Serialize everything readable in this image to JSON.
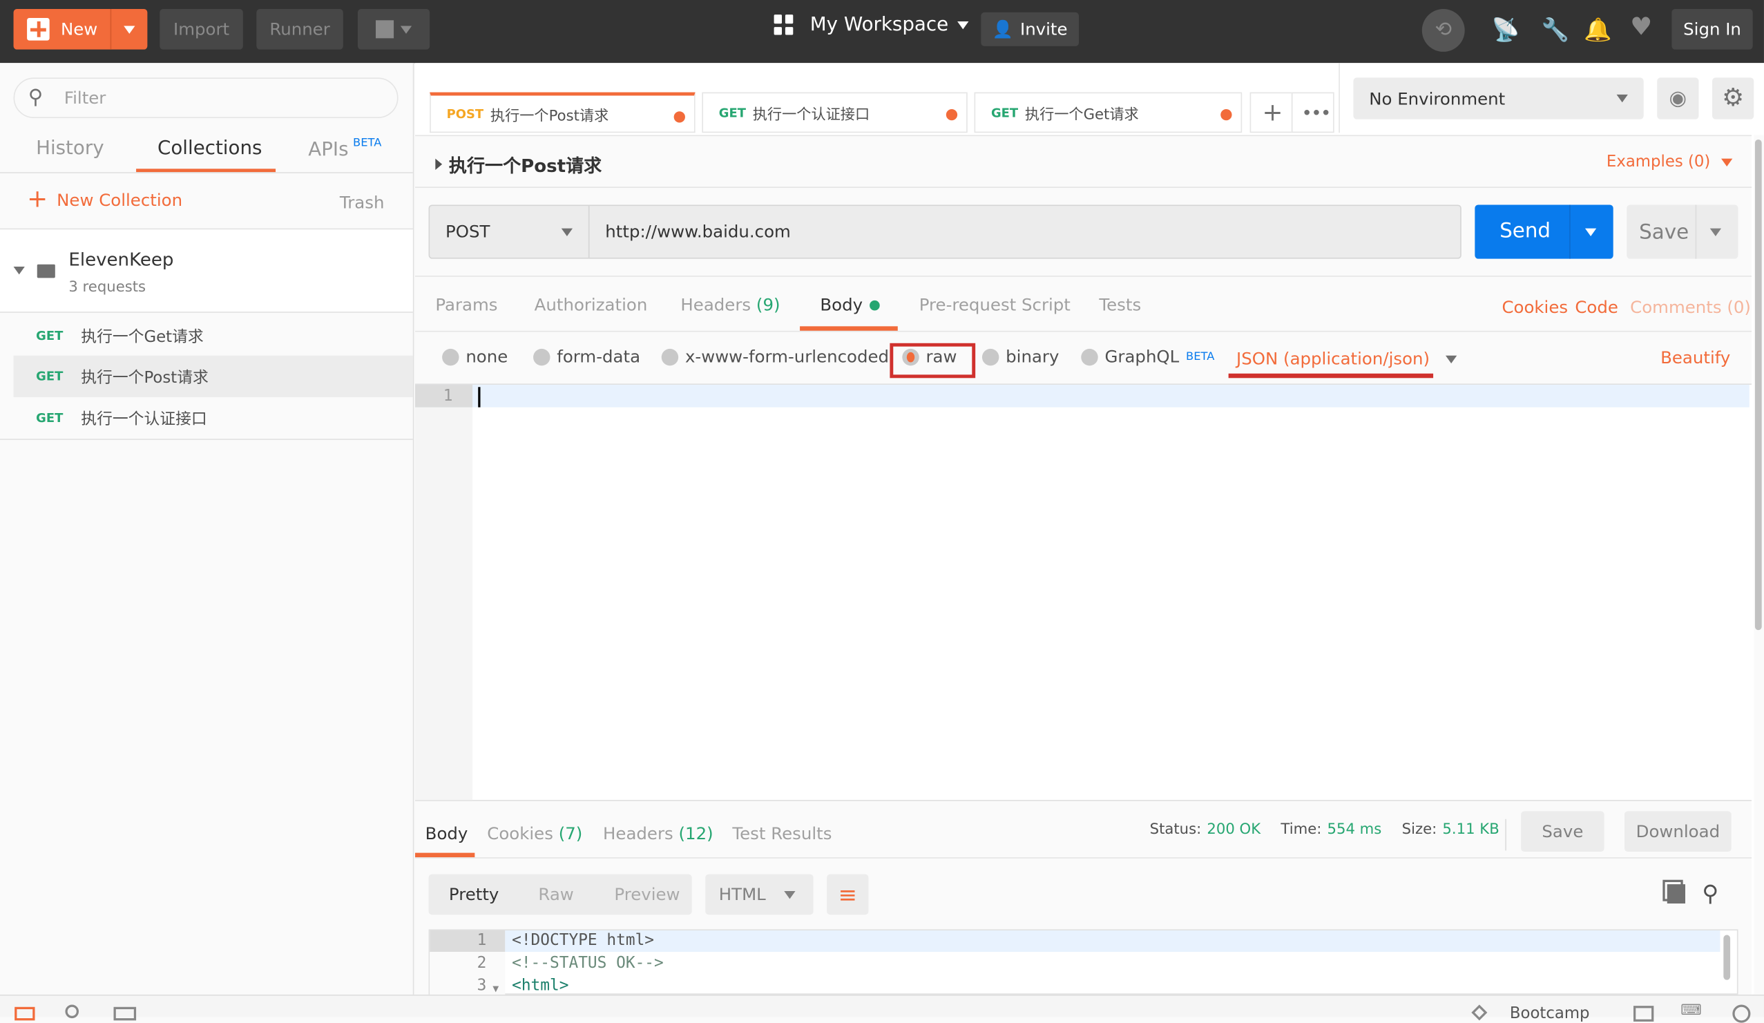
{
  "topbar": {
    "new_label": "New",
    "import_label": "Import",
    "runner_label": "Runner",
    "workspace_label": "My Workspace",
    "invite_label": "Invite",
    "sign_in_label": "Sign In"
  },
  "sidebar": {
    "filter_placeholder": "Filter",
    "tabs": [
      {
        "label": "History"
      },
      {
        "label": "Collections",
        "active": true
      },
      {
        "label": "APIs",
        "badge": "BETA"
      }
    ],
    "new_collection_label": "New Collection",
    "trash_label": "Trash",
    "collection": {
      "name": "ElevenKeep",
      "count": "3 requests",
      "requests": [
        {
          "method": "GET",
          "name": "执行一个Get请求"
        },
        {
          "method": "GET",
          "name": "执行一个Post请求",
          "selected": true
        },
        {
          "method": "GET",
          "name": "执行一个认证接口"
        }
      ]
    }
  },
  "tabs": [
    {
      "method": "POST",
      "name": "执行一个Post请求",
      "active": true
    },
    {
      "method": "GET",
      "name": "执行一个认证接口"
    },
    {
      "method": "GET",
      "name": "执行一个Get请求"
    }
  ],
  "environment": {
    "selected": "No Environment"
  },
  "request": {
    "title": "执行一个Post请求",
    "examples_label": "Examples (0)",
    "method": "POST",
    "url": "http://www.baidu.com",
    "send_label": "Send",
    "save_label": "Save",
    "tabs": [
      {
        "label": "Params"
      },
      {
        "label": "Authorization"
      },
      {
        "label": "Headers",
        "count": "(9)"
      },
      {
        "label": "Body",
        "active": true
      },
      {
        "label": "Pre-request Script"
      },
      {
        "label": "Tests"
      }
    ],
    "links": {
      "cookies": "Cookies",
      "code": "Code",
      "comments": "Comments (0)"
    },
    "body_types": [
      "none",
      "form-data",
      "x-www-form-urlencoded",
      "raw",
      "binary",
      "GraphQL"
    ],
    "selected_body_type": "raw",
    "graphql_badge": "BETA",
    "content_type": "JSON (application/json)",
    "beautify_label": "Beautify",
    "editor_line": "1"
  },
  "response": {
    "tabs": [
      {
        "label": "Body",
        "active": true
      },
      {
        "label": "Cookies",
        "count": "(7)"
      },
      {
        "label": "Headers",
        "count": "(12)"
      },
      {
        "label": "Test Results"
      }
    ],
    "status_label": "Status:",
    "status": "200 OK",
    "time_label": "Time:",
    "time": "554 ms",
    "size_label": "Size:",
    "size": "5.11 KB",
    "save_label": "Save",
    "download_label": "Download",
    "view_modes": [
      "Pretty",
      "Raw",
      "Preview"
    ],
    "format": "HTML",
    "lines": [
      {
        "n": "1",
        "code": "<!DOCTYPE html>"
      },
      {
        "n": "2",
        "code": "<!--STATUS OK-->"
      },
      {
        "n": "3",
        "code": "<html>"
      }
    ]
  },
  "statusbar": {
    "bootcamp_label": "Bootcamp"
  },
  "colors": {
    "accent": "#f26b3a",
    "send": "#097bed",
    "success": "#26a671",
    "highlight": "#d0312d"
  }
}
